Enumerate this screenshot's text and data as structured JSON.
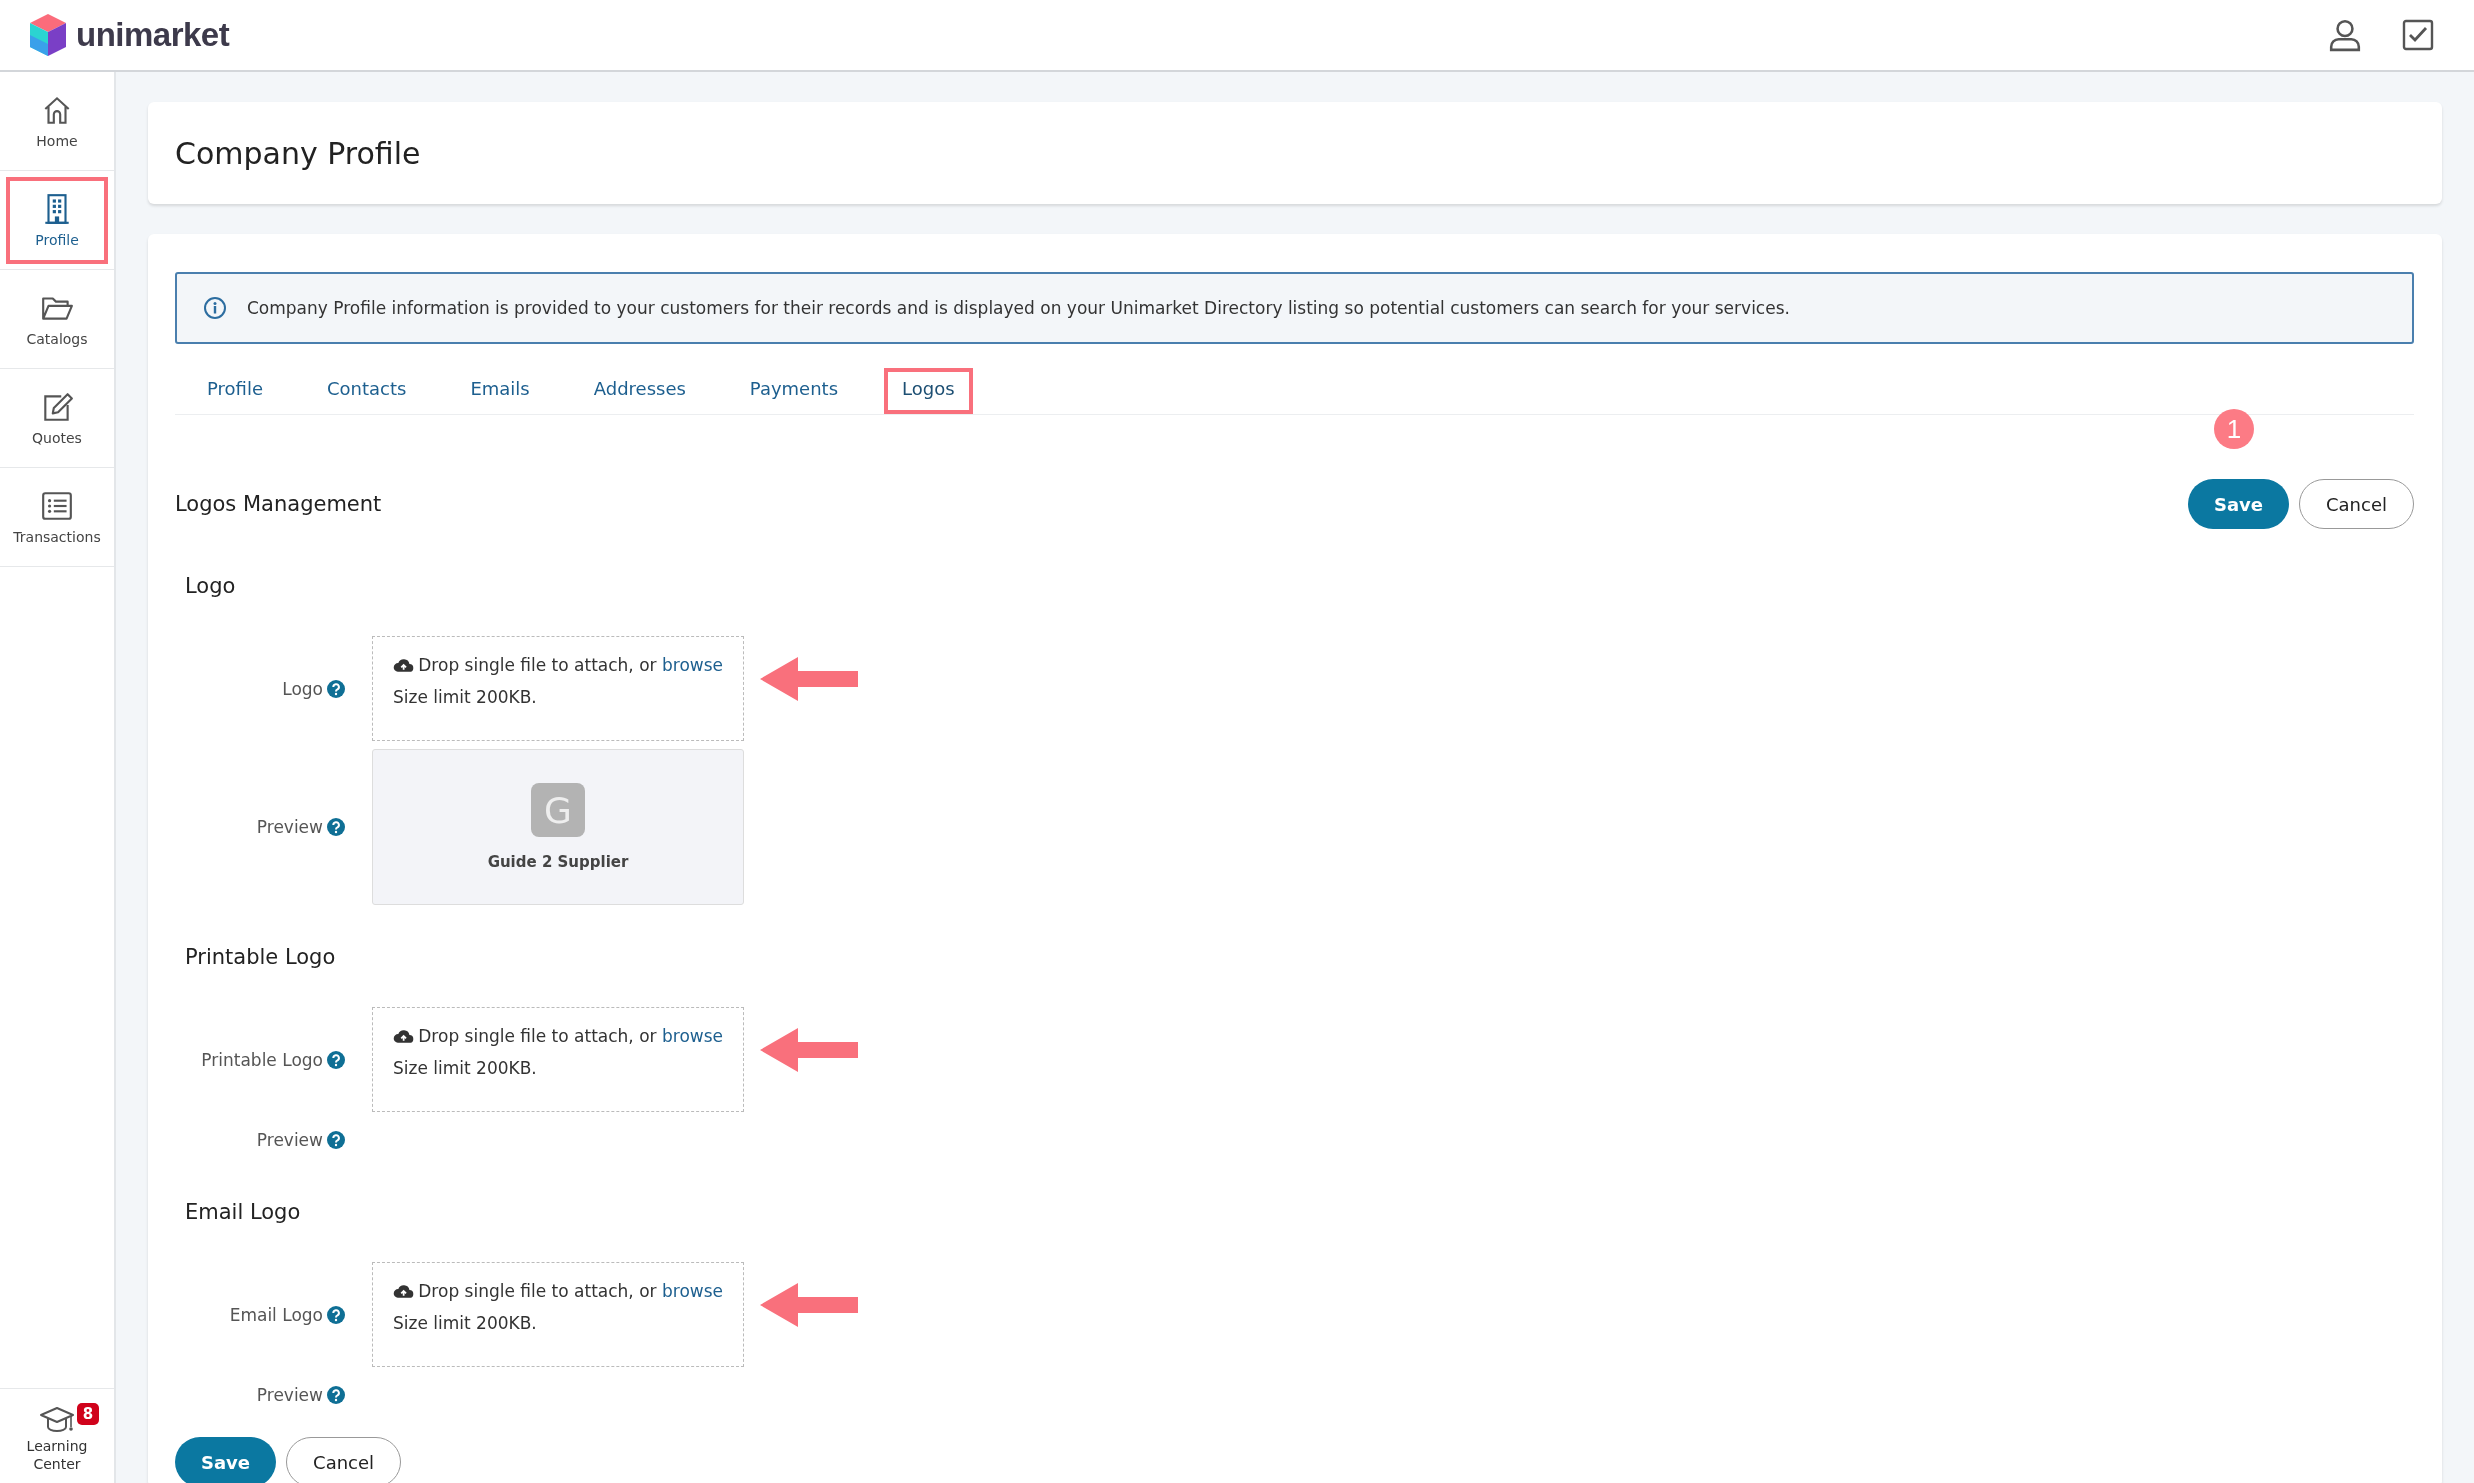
{
  "header": {
    "brand": "unimarket"
  },
  "sidebar": {
    "items": [
      {
        "kind": "home",
        "label": "Home",
        "selected": false,
        "highlighted": false
      },
      {
        "kind": "building",
        "label": "Profile",
        "selected": true,
        "highlighted": true
      },
      {
        "kind": "folder",
        "label": "Catalogs",
        "selected": false,
        "highlighted": false
      },
      {
        "kind": "edit",
        "label": "Quotes",
        "selected": false,
        "highlighted": false
      },
      {
        "kind": "list",
        "label": "Transactions",
        "selected": false,
        "highlighted": false
      }
    ],
    "footer": {
      "label": "Learning Center",
      "badge": "8"
    }
  },
  "page_title": "Company Profile",
  "info_banner": "Company Profile information is provided to your customers for their records and is displayed on your Unimarket Directory listing so potential customers can search for your services.",
  "tabs": [
    {
      "label": "Profile",
      "selected": false,
      "highlighted": false
    },
    {
      "label": "Contacts",
      "selected": false,
      "highlighted": false
    },
    {
      "label": "Emails",
      "selected": false,
      "highlighted": false
    },
    {
      "label": "Addresses",
      "selected": false,
      "highlighted": false
    },
    {
      "label": "Payments",
      "selected": false,
      "highlighted": false
    },
    {
      "label": "Logos",
      "selected": true,
      "highlighted": true
    }
  ],
  "step_badge": "1",
  "section_title": "Logos Management",
  "top_buttons": [
    {
      "kind": "primary",
      "label": "Save"
    },
    {
      "kind": "secondary",
      "label": "Cancel"
    }
  ],
  "logo_groups": [
    {
      "heading": "Logo",
      "upload_label": "Logo",
      "drop_text": "Drop single file to attach, or ",
      "browse": "browse",
      "limit": "Size limit 200KB.",
      "annotation_arrow": true,
      "preview_label": "Preview",
      "preview": {
        "initial": "G",
        "name": "Guide 2 Supplier"
      }
    },
    {
      "heading": "Printable Logo",
      "upload_label": "Printable Logo",
      "drop_text": "Drop single file to attach, or ",
      "browse": "browse",
      "limit": "Size limit 200KB.",
      "annotation_arrow": true,
      "preview_label": "Preview"
    },
    {
      "heading": "Email Logo",
      "upload_label": "Email Logo",
      "drop_text": "Drop single file to attach, or ",
      "browse": "browse",
      "limit": "Size limit 200KB.",
      "annotation_arrow": true,
      "preview_label": "Preview"
    }
  ],
  "bottom_buttons": [
    {
      "kind": "primary",
      "label": "Save"
    },
    {
      "kind": "secondary",
      "label": "Cancel"
    }
  ]
}
